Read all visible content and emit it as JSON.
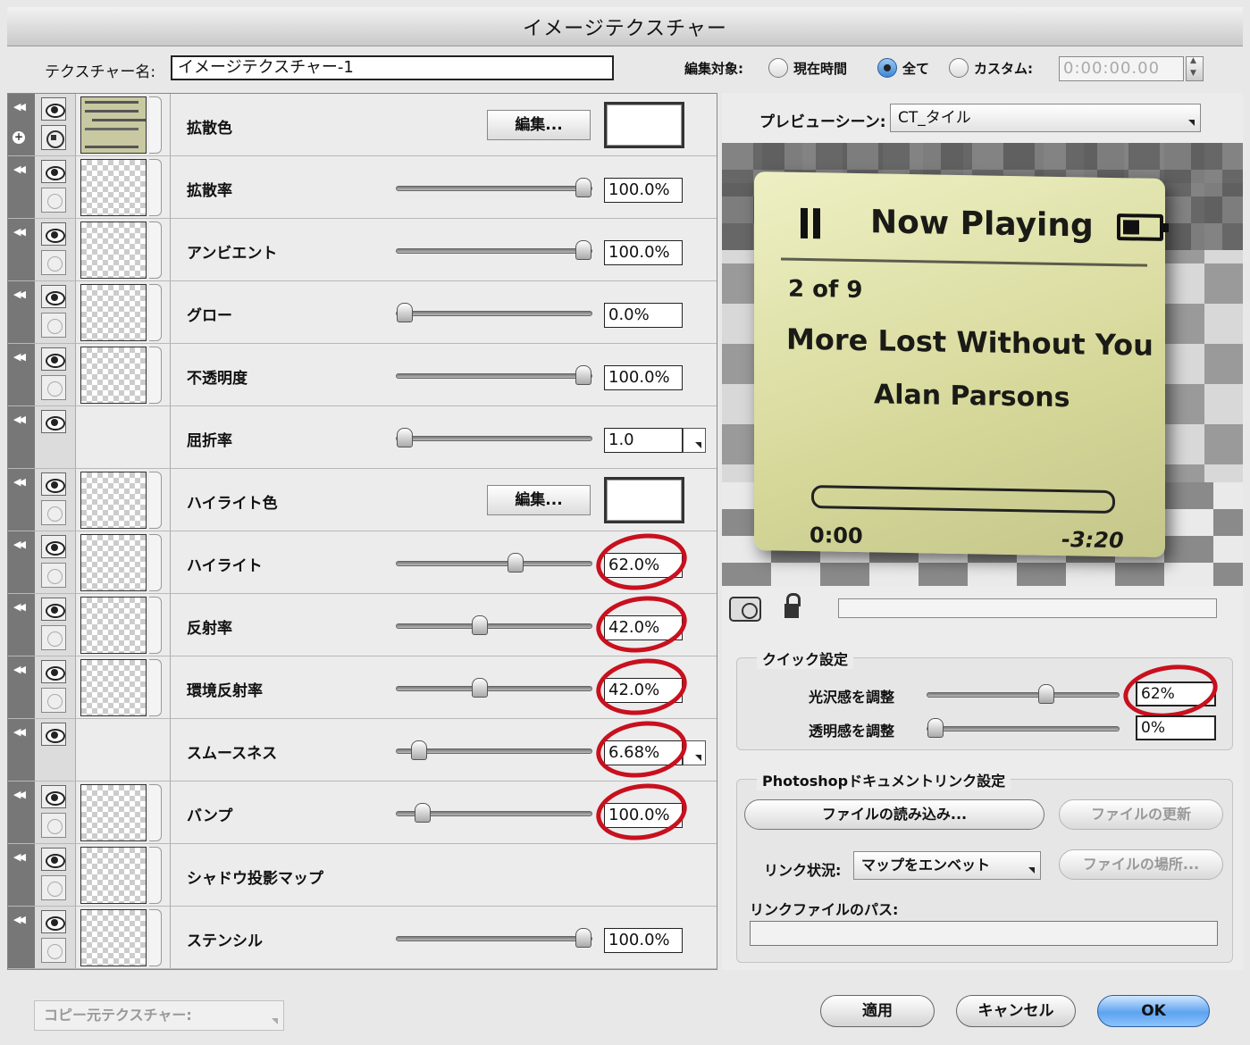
{
  "window": {
    "title": "イメージテクスチャー"
  },
  "top": {
    "texture_name_label": "テクスチャー名:",
    "texture_name_value": "イメージテクスチャー-1",
    "edit_target_label": "編集対象:",
    "radio_current": "現在時間",
    "radio_all": "全て",
    "radio_custom": "カスタム:",
    "selected_radio": "全て",
    "time_value": "0:00:00.00"
  },
  "rows": [
    {
      "label": "拡散色",
      "kind": "color",
      "edit_label": "編集...",
      "has_image": true
    },
    {
      "label": "拡散率",
      "kind": "slider",
      "value": "100.0%",
      "level": 100
    },
    {
      "label": "アンビエント",
      "kind": "slider",
      "value": "100.0%",
      "level": 100
    },
    {
      "label": "グロー",
      "kind": "slider",
      "value": "0.0%",
      "level": 0
    },
    {
      "label": "不透明度",
      "kind": "slider",
      "value": "100.0%",
      "level": 100
    },
    {
      "label": "屈折率",
      "kind": "slider",
      "value": "1.0",
      "level": 0,
      "dropdown": true
    },
    {
      "label": "ハイライト色",
      "kind": "color",
      "edit_label": "編集..."
    },
    {
      "label": "ハイライト",
      "kind": "slider",
      "value": "62.0%",
      "level": 62,
      "circled": true
    },
    {
      "label": "反射率",
      "kind": "slider",
      "value": "42.0%",
      "level": 42,
      "circled": true
    },
    {
      "label": "環境反射率",
      "kind": "slider",
      "value": "42.0%",
      "level": 42,
      "circled": true
    },
    {
      "label": "スムースネス",
      "kind": "slider",
      "value": "6.68%",
      "level": 8,
      "circled": true,
      "dropdown": true
    },
    {
      "label": "バンプ",
      "kind": "slider",
      "value": "100.0%",
      "level": 10,
      "circled": true
    },
    {
      "label": "シャドウ投影マップ",
      "kind": "none"
    },
    {
      "label": "ステンシル",
      "kind": "slider",
      "value": "100.0%",
      "level": 100
    }
  ],
  "preview": {
    "scene_label": "プレビューシーン:",
    "scene_value": "CT_タイル",
    "screen": {
      "now_playing": "Now Playing",
      "track_index": "2 of 9",
      "song": "More Lost Without You",
      "artist": "Alan Parsons",
      "elapsed": "0:00",
      "remaining": "-3:20",
      "progress": 0.0
    }
  },
  "quick": {
    "legend": "クイック設定",
    "gloss_label": "光沢感を調整",
    "gloss_value": "62%",
    "gloss_level": 62,
    "transparency_label": "透明感を調整",
    "transparency_value": "0%",
    "transparency_level": 0
  },
  "photoshop": {
    "legend": "Photoshopドキュメントリンク設定",
    "load_button": "ファイルの読み込み...",
    "update_button": "ファイルの更新",
    "link_status_label": "リンク状況:",
    "link_status_value": "マップをエンベット",
    "locate_button": "ファイルの場所...",
    "path_label": "リンクファイルのパス:",
    "path_value": ""
  },
  "bottom": {
    "copy_source": "コピー元テクスチャー:",
    "apply": "適用",
    "cancel": "キャンセル",
    "ok": "OK"
  },
  "colors": {
    "circle": "#c8101e",
    "ok_button": "#5ea3ef"
  }
}
